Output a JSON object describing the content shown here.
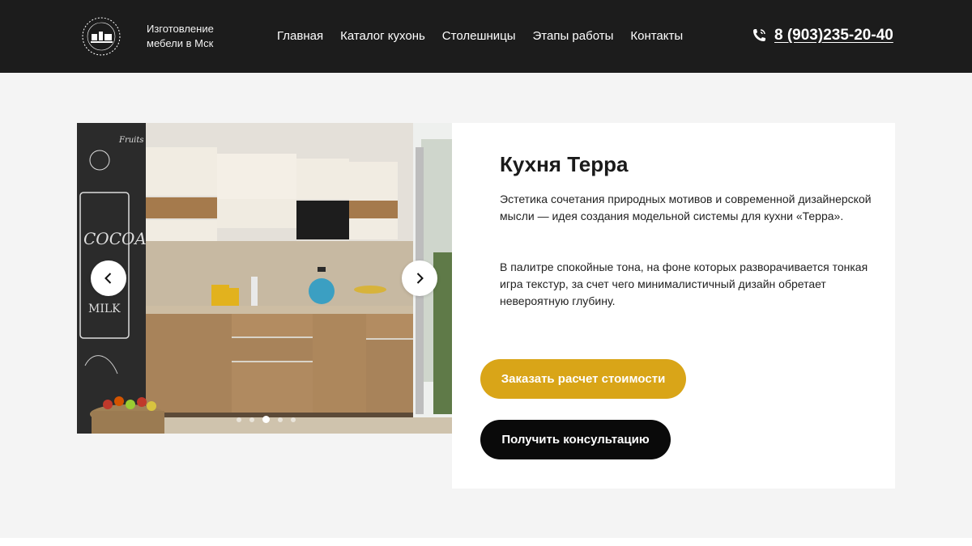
{
  "header": {
    "brand_line1": "Изготовление",
    "brand_line2": "мебели в Мск",
    "logo_text": "Мебельный дом",
    "nav": [
      "Главная",
      "Каталог кухонь",
      "Столешницы",
      "Этапы работы",
      "Контакты"
    ],
    "phone": "8 (903)235-20-40",
    "icons": {
      "phone": "phone-icon",
      "logo": "logo-icon"
    }
  },
  "slider": {
    "prev_icon": "chevron-left-icon",
    "next_icon": "chevron-right-icon",
    "slides_count": 5,
    "active_index": 2,
    "chalkboard_text": [
      "Fruits",
      "COCOA",
      "MILK"
    ]
  },
  "card": {
    "title": "Кухня Терра",
    "paragraph1": "Эстетика сочетания природных мотивов и современной дизайнерской мысли — идея создания модельной системы для кухни «Терра».",
    "paragraph2": "В палитре спокойные тона, на фоне которых разворачивается тонкая игра текстур, за счет чего минималистичный дизайн обретает невероятную глубину.",
    "order_button": "Заказать расчет стоимости",
    "consult_button": "Получить консультацию"
  },
  "colors": {
    "header_bg": "#1c1c1c",
    "page_bg": "#f4f4f4",
    "accent": "#d9a518",
    "dark_button": "#0a0a0a"
  }
}
